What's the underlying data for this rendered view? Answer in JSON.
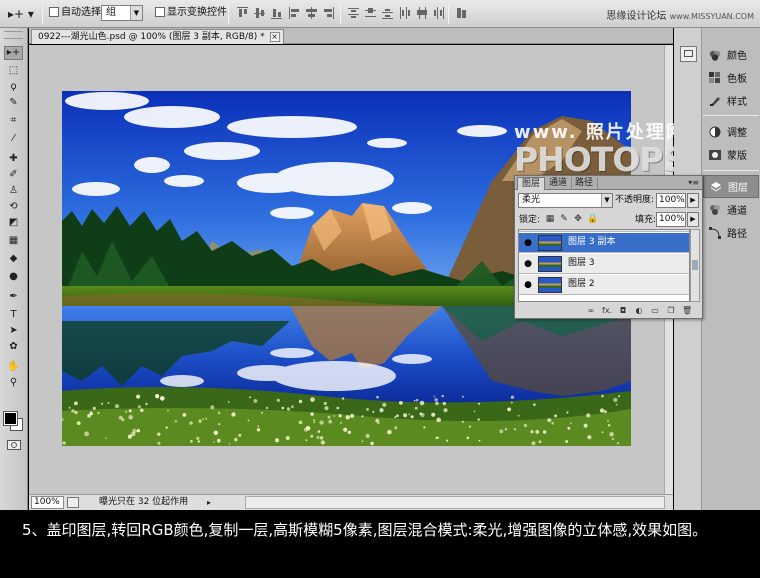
{
  "options_bar": {
    "tool_preset": "▸+ ▾",
    "auto_select_label": "自动选择:",
    "auto_select_value": "组",
    "show_transform_label": "显示变换控件"
  },
  "site_watermark": {
    "text": "思缘设计论坛",
    "url": "www.MISSYUAN.COM"
  },
  "document": {
    "tab_title": "0922---湖光山色.psd @ 100% (图层 3 副本, RGB/8) *",
    "tab_close": "×",
    "zoom": "100%",
    "status": "曝光只在 32 位起作用",
    "status_arrow": "▸"
  },
  "photo_watermark": {
    "site": "www. 照片处理网",
    "brand": "PHOTOPS.COM"
  },
  "tools": [
    {
      "name": "move-tool",
      "glyph": "▸+",
      "active": true
    },
    {
      "name": "marquee-tool",
      "glyph": "⬚"
    },
    {
      "name": "lasso-tool",
      "glyph": "ϙ"
    },
    {
      "name": "quick-select-tool",
      "glyph": "✎"
    },
    {
      "name": "crop-tool",
      "glyph": "⌗"
    },
    {
      "name": "eyedropper-tool",
      "glyph": "⁄"
    },
    {
      "name": "healing-tool",
      "glyph": "✚"
    },
    {
      "name": "brush-tool",
      "glyph": "✐"
    },
    {
      "name": "stamp-tool",
      "glyph": "♙"
    },
    {
      "name": "history-brush-tool",
      "glyph": "⟲"
    },
    {
      "name": "eraser-tool",
      "glyph": "◩"
    },
    {
      "name": "gradient-tool",
      "glyph": "▦"
    },
    {
      "name": "blur-tool",
      "glyph": "◆"
    },
    {
      "name": "dodge-tool",
      "glyph": "●"
    },
    {
      "name": "pen-tool",
      "glyph": "✒"
    },
    {
      "name": "type-tool",
      "glyph": "T"
    },
    {
      "name": "path-select-tool",
      "glyph": "➤"
    },
    {
      "name": "shape-tool",
      "glyph": "✿"
    },
    {
      "name": "hand-tool",
      "glyph": "✋"
    },
    {
      "name": "zoom-tool",
      "glyph": "⚲"
    }
  ],
  "dock": {
    "group1": [
      {
        "label": "颜色",
        "icon": "color-icon"
      },
      {
        "label": "色板",
        "icon": "swatches-icon"
      },
      {
        "label": "样式",
        "icon": "styles-icon"
      }
    ],
    "group2": [
      {
        "label": "调整",
        "icon": "adjustments-icon"
      },
      {
        "label": "蒙版",
        "icon": "masks-icon"
      }
    ],
    "group3": [
      {
        "label": "图层",
        "icon": "layers-icon",
        "active": true
      },
      {
        "label": "通道",
        "icon": "channels-icon"
      },
      {
        "label": "路径",
        "icon": "paths-icon"
      }
    ]
  },
  "layers_panel": {
    "tabs": [
      "图层",
      "通道",
      "路径"
    ],
    "menu": "▾≡",
    "blend_mode": "柔光",
    "opacity_label": "不透明度:",
    "opacity": "100%",
    "lock_label": "锁定:",
    "fill_label": "填充:",
    "fill": "100%",
    "layers": [
      {
        "name": "图层 3 副本",
        "selected": true
      },
      {
        "name": "图层 3",
        "selected": false
      },
      {
        "name": "图层 2",
        "selected": false
      }
    ],
    "footer_icons": [
      "∞",
      "fx.",
      "◘",
      "◐",
      "▭",
      "❐",
      "🗑"
    ]
  },
  "caption": "5、盖印图层,转回RGB颜色,复制一层,高斯模糊5像素,图层混合模式:柔光,增强图像的立体感,效果如图。"
}
